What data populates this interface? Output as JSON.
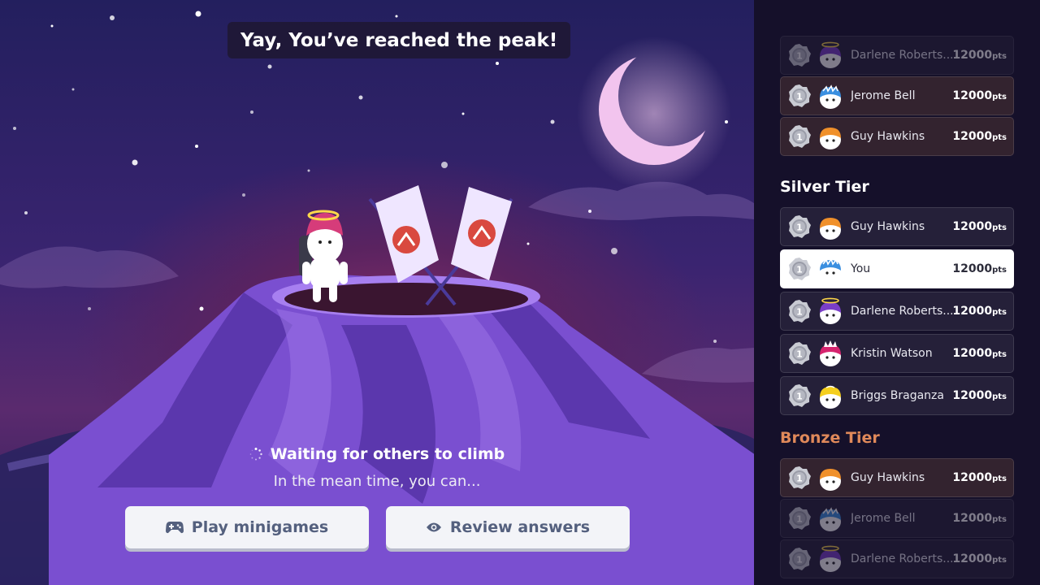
{
  "banner": "Yay, You’ve reached the peak!",
  "status": {
    "waiting": "Waiting for others to climb",
    "meantime": "In the mean time, you can..."
  },
  "actions": {
    "minigames": "Play minigames",
    "review": "Review answers"
  },
  "leaderboard": {
    "gold_rows": [
      {
        "rank": "1",
        "name": "Darlene Roberts...",
        "points": "12000",
        "unit": "pts",
        "avatar": "purple-helmet-halo"
      },
      {
        "rank": "1",
        "name": "Jerome Bell",
        "points": "12000",
        "unit": "pts",
        "avatar": "blue-helmet"
      },
      {
        "rank": "1",
        "name": "Guy Hawkins",
        "points": "12000",
        "unit": "pts",
        "avatar": "orange-helmet"
      }
    ],
    "silver": {
      "title": "Silver Tier",
      "rows": [
        {
          "rank": "1",
          "name": "Guy Hawkins",
          "points": "12000",
          "unit": "pts",
          "avatar": "orange-helmet"
        },
        {
          "rank": "1",
          "name": "You",
          "points": "12000",
          "unit": "pts",
          "avatar": "blue-helmet"
        },
        {
          "rank": "1",
          "name": "Darlene Roberts...",
          "points": "12000",
          "unit": "pts",
          "avatar": "purple-helmet-halo"
        },
        {
          "rank": "1",
          "name": "Kristin Watson",
          "points": "12000",
          "unit": "pts",
          "avatar": "pink-spiked-helmet"
        },
        {
          "rank": "1",
          "name": "Briggs Braganza",
          "points": "12000",
          "unit": "pts",
          "avatar": "yellow-helmet"
        }
      ]
    },
    "bronze": {
      "title": "Bronze Tier",
      "rows": [
        {
          "rank": "1",
          "name": "Guy Hawkins",
          "points": "12000",
          "unit": "pts",
          "avatar": "orange-helmet"
        },
        {
          "rank": "1",
          "name": "Jerome Bell",
          "points": "12000",
          "unit": "pts",
          "avatar": "blue-helmet"
        },
        {
          "rank": "1",
          "name": "Darlene Roberts...",
          "points": "12000",
          "unit": "pts",
          "avatar": "purple-helmet-halo"
        }
      ]
    }
  },
  "colors": {
    "silver_title": "#ffffff",
    "bronze_title": "#e0895a",
    "button_text": "#54607e",
    "moon": "#f2c4ee"
  }
}
